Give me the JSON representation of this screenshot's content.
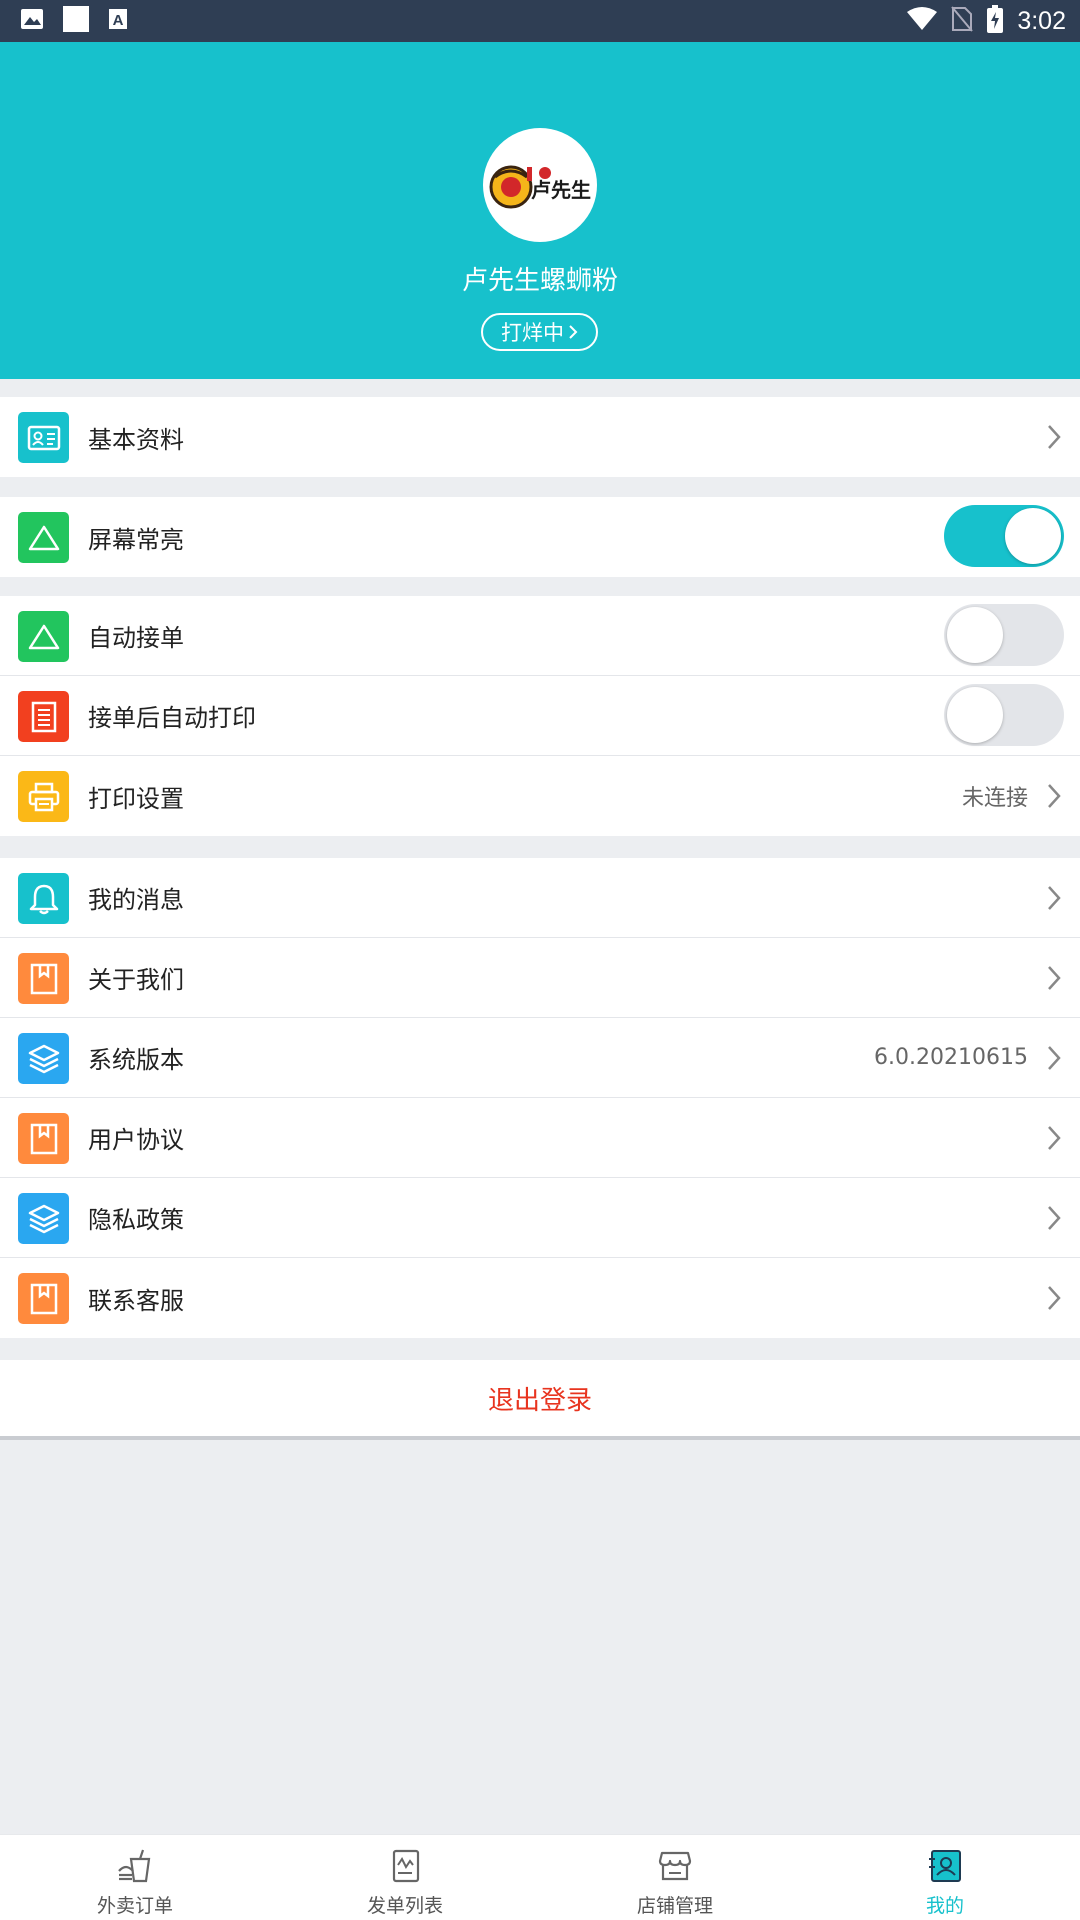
{
  "status_bar": {
    "time": "3:02"
  },
  "header": {
    "shop_name": "卢先生螺蛳粉",
    "status_label": "打烊中",
    "logo_text": "卢先生"
  },
  "colors": {
    "accent": "#17c1cc",
    "status_bar": "#2f3e54",
    "logout_red": "#e8341f",
    "green": "#22c55e",
    "red_orange": "#f2401f",
    "yellow": "#fbb817",
    "orange": "#ff8a3d",
    "blue": "#2aa7f0"
  },
  "settings": {
    "basic_info": {
      "label": "基本资料",
      "icon": "id-card-icon"
    },
    "keep_screen_on": {
      "label": "屏幕常亮",
      "icon": "triangle-icon",
      "enabled": true
    },
    "auto_accept": {
      "label": "自动接单",
      "icon": "triangle-icon",
      "enabled": false
    },
    "auto_print": {
      "label": "接单后自动打印",
      "icon": "receipt-icon",
      "enabled": false
    },
    "print_settings": {
      "label": "打印设置",
      "value": "未连接",
      "icon": "printer-icon"
    },
    "my_messages": {
      "label": "我的消息",
      "icon": "bell-icon"
    },
    "about_us": {
      "label": "关于我们",
      "icon": "bookmark-icon"
    },
    "system_version": {
      "label": "系统版本",
      "value": "6.0.20210615",
      "icon": "layers-icon"
    },
    "user_agreement": {
      "label": "用户协议",
      "icon": "bookmark-icon"
    },
    "privacy_policy": {
      "label": "隐私政策",
      "icon": "layers-icon"
    },
    "contact_support": {
      "label": "联系客服",
      "icon": "bookmark-icon"
    }
  },
  "logout_label": "退出登录",
  "bottom_nav": [
    {
      "label": "外卖订单",
      "icon": "takeout-icon",
      "active": false
    },
    {
      "label": "发单列表",
      "icon": "document-icon",
      "active": false
    },
    {
      "label": "店铺管理",
      "icon": "store-icon",
      "active": false
    },
    {
      "label": "我的",
      "icon": "profile-icon",
      "active": true
    }
  ]
}
